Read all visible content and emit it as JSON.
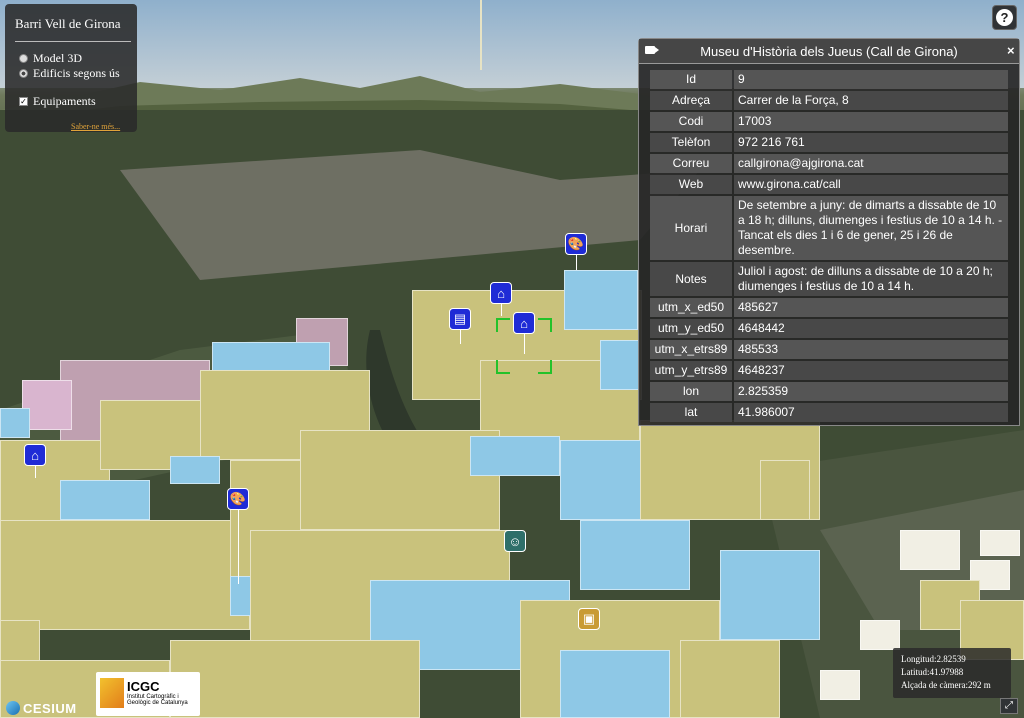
{
  "layer_panel": {
    "title": "Barri Vell de Girona",
    "options": [
      {
        "label": "Model 3D",
        "type": "radio",
        "checked": false
      },
      {
        "label": "Edificis segons ús",
        "type": "radio",
        "checked": true
      },
      {
        "label": "Equipaments",
        "type": "checkbox",
        "checked": true
      }
    ],
    "more_link": "Saber-ne més..."
  },
  "help_button": {
    "icon": "help-icon",
    "symbol": "?"
  },
  "infobox": {
    "title": "Museu d'Història dels Jueus (Call de Girona)",
    "camera_icon": "camera-icon",
    "close_symbol": "×",
    "rows": [
      {
        "key": "Id",
        "value": "9"
      },
      {
        "key": "Adreça",
        "value": "Carrer de la Força, 8"
      },
      {
        "key": "Codi",
        "value": "17003"
      },
      {
        "key": "Telèfon",
        "value": "972 216 761"
      },
      {
        "key": "Correu",
        "value": "callgirona@ajgirona.cat"
      },
      {
        "key": "Web",
        "value": "www.girona.cat/call"
      },
      {
        "key": "Horari",
        "value": "De setembre a juny: de dimarts a dissabte de 10 a 18 h; dilluns, diumenges i festius de 10 a 14 h. - Tancat els dies 1 i 6 de gener, 25 i 26 de desembre."
      },
      {
        "key": "Notes",
        "value": "Juliol i agost: de dilluns a dissabte de 10 a 20 h; diumenges i festius de 10 a 14 h."
      },
      {
        "key": "utm_x_ed50",
        "value": "485627"
      },
      {
        "key": "utm_y_ed50",
        "value": "4648442"
      },
      {
        "key": "utm_x_etrs89",
        "value": "485533"
      },
      {
        "key": "utm_y_etrs89",
        "value": "4648237"
      },
      {
        "key": "lon",
        "value": "2.825359"
      },
      {
        "key": "lat",
        "value": "41.986007"
      }
    ]
  },
  "coordinates": {
    "longitude": "Longitud:2.82539",
    "latitude": "Latitud:41.97988",
    "camera_height": "Alçada de càmera:292 m"
  },
  "fullscreen_button": {
    "icon": "fullscreen-icon",
    "symbol": "⤢"
  },
  "credits": {
    "cesium": "CESIUM",
    "icgc_short": "ICGC",
    "icgc_full": "Institut Cartogràfic i Geològic de Catalunya"
  },
  "pois": [
    {
      "icon": "palette-icon",
      "symbol": "🎨",
      "color": "#1f2bd6"
    },
    {
      "icon": "museum-icon",
      "symbol": "⌂",
      "color": "#1f2bd6"
    },
    {
      "icon": "library-icon",
      "symbol": "▤",
      "color": "#1f2bd6"
    },
    {
      "icon": "museum-icon",
      "symbol": "⌂",
      "color": "#1f2bd6"
    },
    {
      "icon": "museum-icon",
      "symbol": "⌂",
      "color": "#1f2bd6"
    },
    {
      "icon": "palette-icon",
      "symbol": "🎨",
      "color": "#1f2bd6"
    },
    {
      "icon": "theater-icon",
      "symbol": "☺",
      "color": "#2f6f6a"
    },
    {
      "icon": "cinema-icon",
      "symbol": "▣",
      "color": "#c99b34"
    }
  ],
  "legend_colors": {
    "residential": "#c9c27c",
    "equipment": "#8ec8e6",
    "other": "#bfa0b0"
  }
}
